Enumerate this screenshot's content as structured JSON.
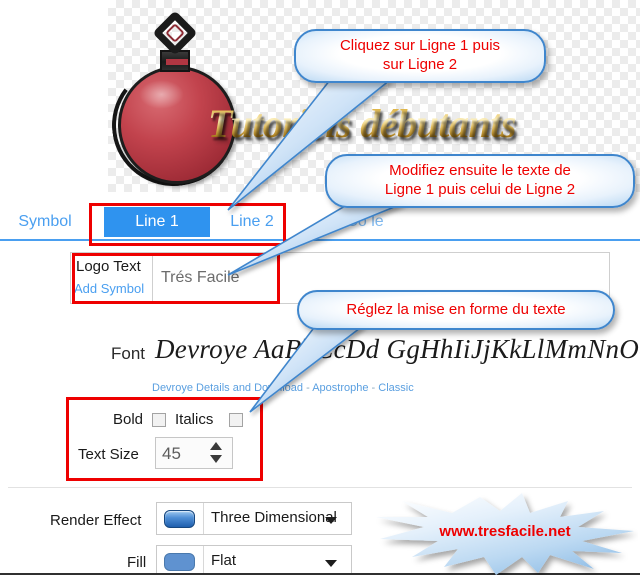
{
  "header": {
    "site_title": "Tutoriels débutants",
    "logo_icon": "christmas-bauble-icon"
  },
  "tabs": [
    {
      "label": "Symbol",
      "active": false
    },
    {
      "label": "Line 1",
      "active": true
    },
    {
      "label": "Line 2",
      "active": false
    },
    {
      "label": "Co       le",
      "active": false
    }
  ],
  "logo_text": {
    "label": "Logo Text",
    "add_symbol_link": "Add Symbol",
    "value": "Trés Facile",
    "placeholder": ""
  },
  "font": {
    "label": "Font",
    "sample": "Devroye AaBbCcDd       GgHhIiJjKkLlMmNnOoP",
    "links": {
      "details": "Devroye Details and Download",
      "sep1": "-",
      "apostrophe": "Apostrophe",
      "sep2": "-",
      "classic": "Classic"
    }
  },
  "format": {
    "bold_label": "Bold",
    "bold_checked": false,
    "italics_label": "Italics",
    "italics_checked": false,
    "text_size_label": "Text Size",
    "text_size_value": "45"
  },
  "render": {
    "render_effect_label": "Render Effect",
    "render_effect_value": "Three Dimensional",
    "fill_label": "Fill",
    "fill_value": "Flat"
  },
  "callouts": {
    "one_line1": "Cliquez sur Ligne 1 puis",
    "one_line2": "sur Ligne 2",
    "two_line1": "Modifiez ensuite le texte de",
    "two_line2": "Ligne 1 puis celui de  Ligne 2",
    "three": "Réglez la mise en forme du texte"
  },
  "watermark": {
    "text": "www.tresfacile.net"
  },
  "colors": {
    "accent_blue": "#2f93ef",
    "tab_link_blue": "#4a9ff0",
    "annotation_red": "#ee0000",
    "callout_border": "#3f86cd",
    "gold": "#e0b74b",
    "bauble_red": "#c2434d"
  }
}
